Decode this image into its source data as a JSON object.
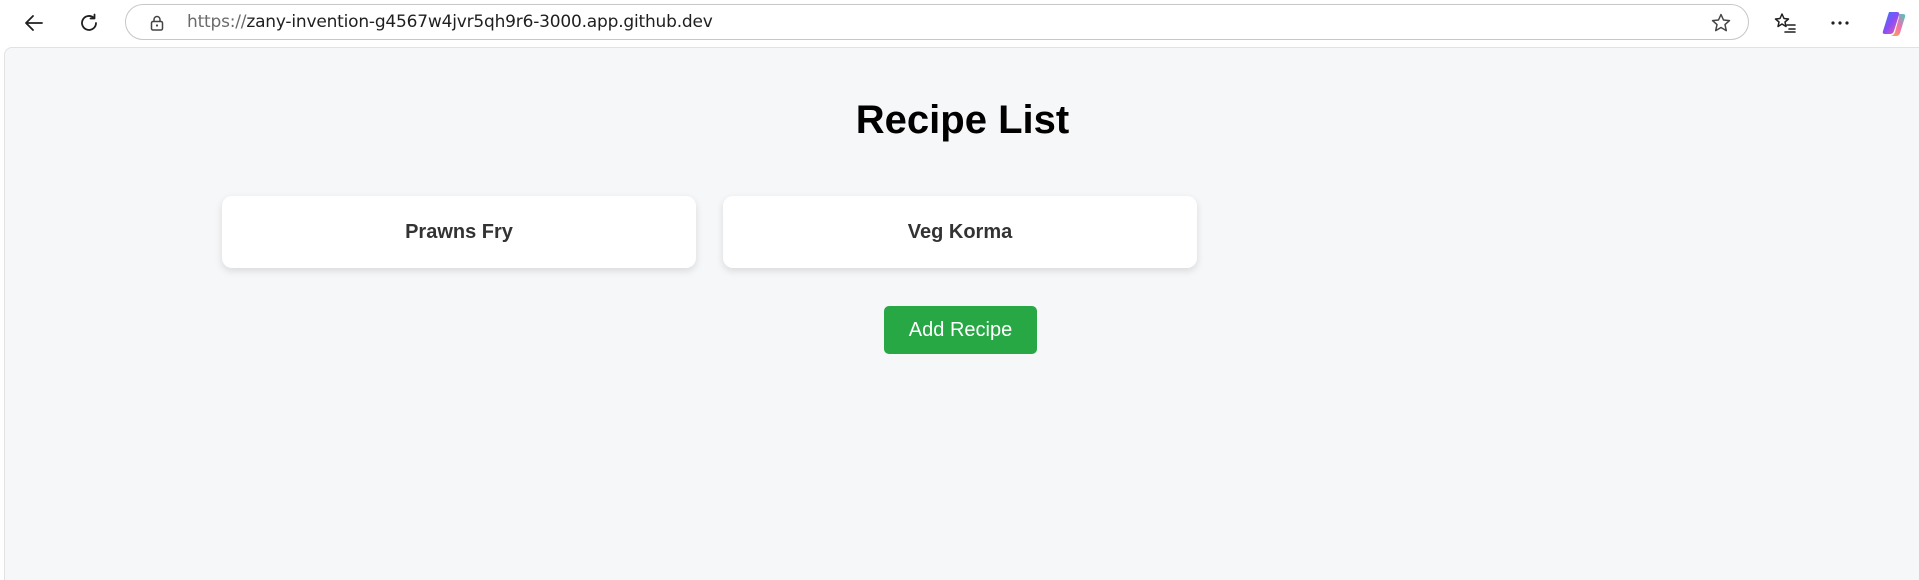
{
  "browser": {
    "url_prefix": "https://",
    "url_host": "zany-invention-g4567w4jvr5qh9r6-3000.app.github.dev",
    "icons": [
      "back-icon",
      "refresh-icon",
      "lock-icon",
      "star-icon",
      "favorites-icon",
      "more-icon",
      "copilot-icon"
    ]
  },
  "page": {
    "title": "Recipe List",
    "recipes": [
      {
        "name": "Prawns Fry"
      },
      {
        "name": "Veg Korma"
      }
    ],
    "add_button_label": "Add Recipe"
  },
  "colors": {
    "page_background": "#f6f7f9",
    "card_background": "#ffffff",
    "add_button": "#28a745",
    "add_button_text": "#ffffff"
  }
}
